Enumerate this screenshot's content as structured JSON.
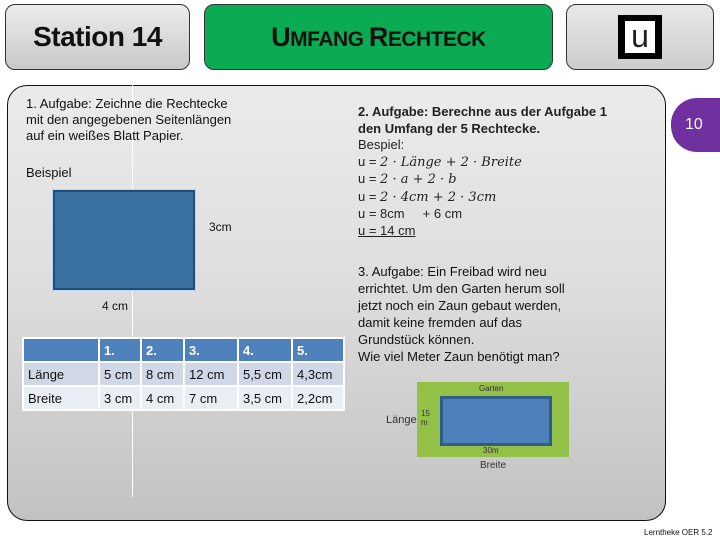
{
  "header": {
    "station": "Station 14",
    "title_cap1": "U",
    "title_rest1": "MFANG ",
    "title_cap2": "R",
    "title_rest2": "ECHTECK",
    "logo_letter": "u",
    "title_color": "#0aab52"
  },
  "badge": {
    "number": "10",
    "color": "#7030a0"
  },
  "task1": {
    "lines": [
      "1. Aufgabe: Zeichne die Rechtecke",
      "mit den angegebenen Seitenlängen",
      "auf ein weißes Blatt Papier."
    ],
    "example_label": "Beispiel",
    "example_height": "3cm",
    "example_width": "4 cm"
  },
  "table": {
    "headers": [
      "",
      "1.",
      "2.",
      "3.",
      "4.",
      "5."
    ],
    "rows": [
      {
        "label": "Länge",
        "values": [
          "5 cm",
          "8 cm",
          "12 cm",
          "5,5 cm",
          "4,3cm"
        ]
      },
      {
        "label": "Breite",
        "values": [
          "3 cm",
          "4 cm",
          "7 cm",
          "3,5 cm",
          "2,2cm"
        ]
      }
    ]
  },
  "task2": {
    "title_line1": "2. Aufgabe: Berechne aus der Aufgabe 1",
    "title_line2": "den Umfang der 5 Rechtecke.",
    "example_label": "Bespiel:",
    "formula1_prefix": "u = ",
    "formula1": "2 · Länge + 2 · Breite",
    "formula2": "2 · a + 2 · b",
    "formula3": "2 · 4cm + 2 · 3cm",
    "line4": "u = 8cm     + 6 cm",
    "result": "u = 14 cm"
  },
  "task3": {
    "lines": [
      "3. Aufgabe: Ein Freibad wird neu",
      "errichtet. Um den Garten herum soll",
      "jetzt noch ein Zaun gebaut werden,",
      "damit keine fremden auf das",
      "Grundstück können.",
      "Wie viel Meter Zaun benötigt man?"
    ],
    "diagram": {
      "garden_label": "Garten",
      "side_value_1": "15",
      "side_value_2": "m",
      "bottom_value": "30m",
      "length_label": "Länge",
      "width_label": "Breite"
    }
  },
  "footer": "Lerntheke OER 5.2"
}
